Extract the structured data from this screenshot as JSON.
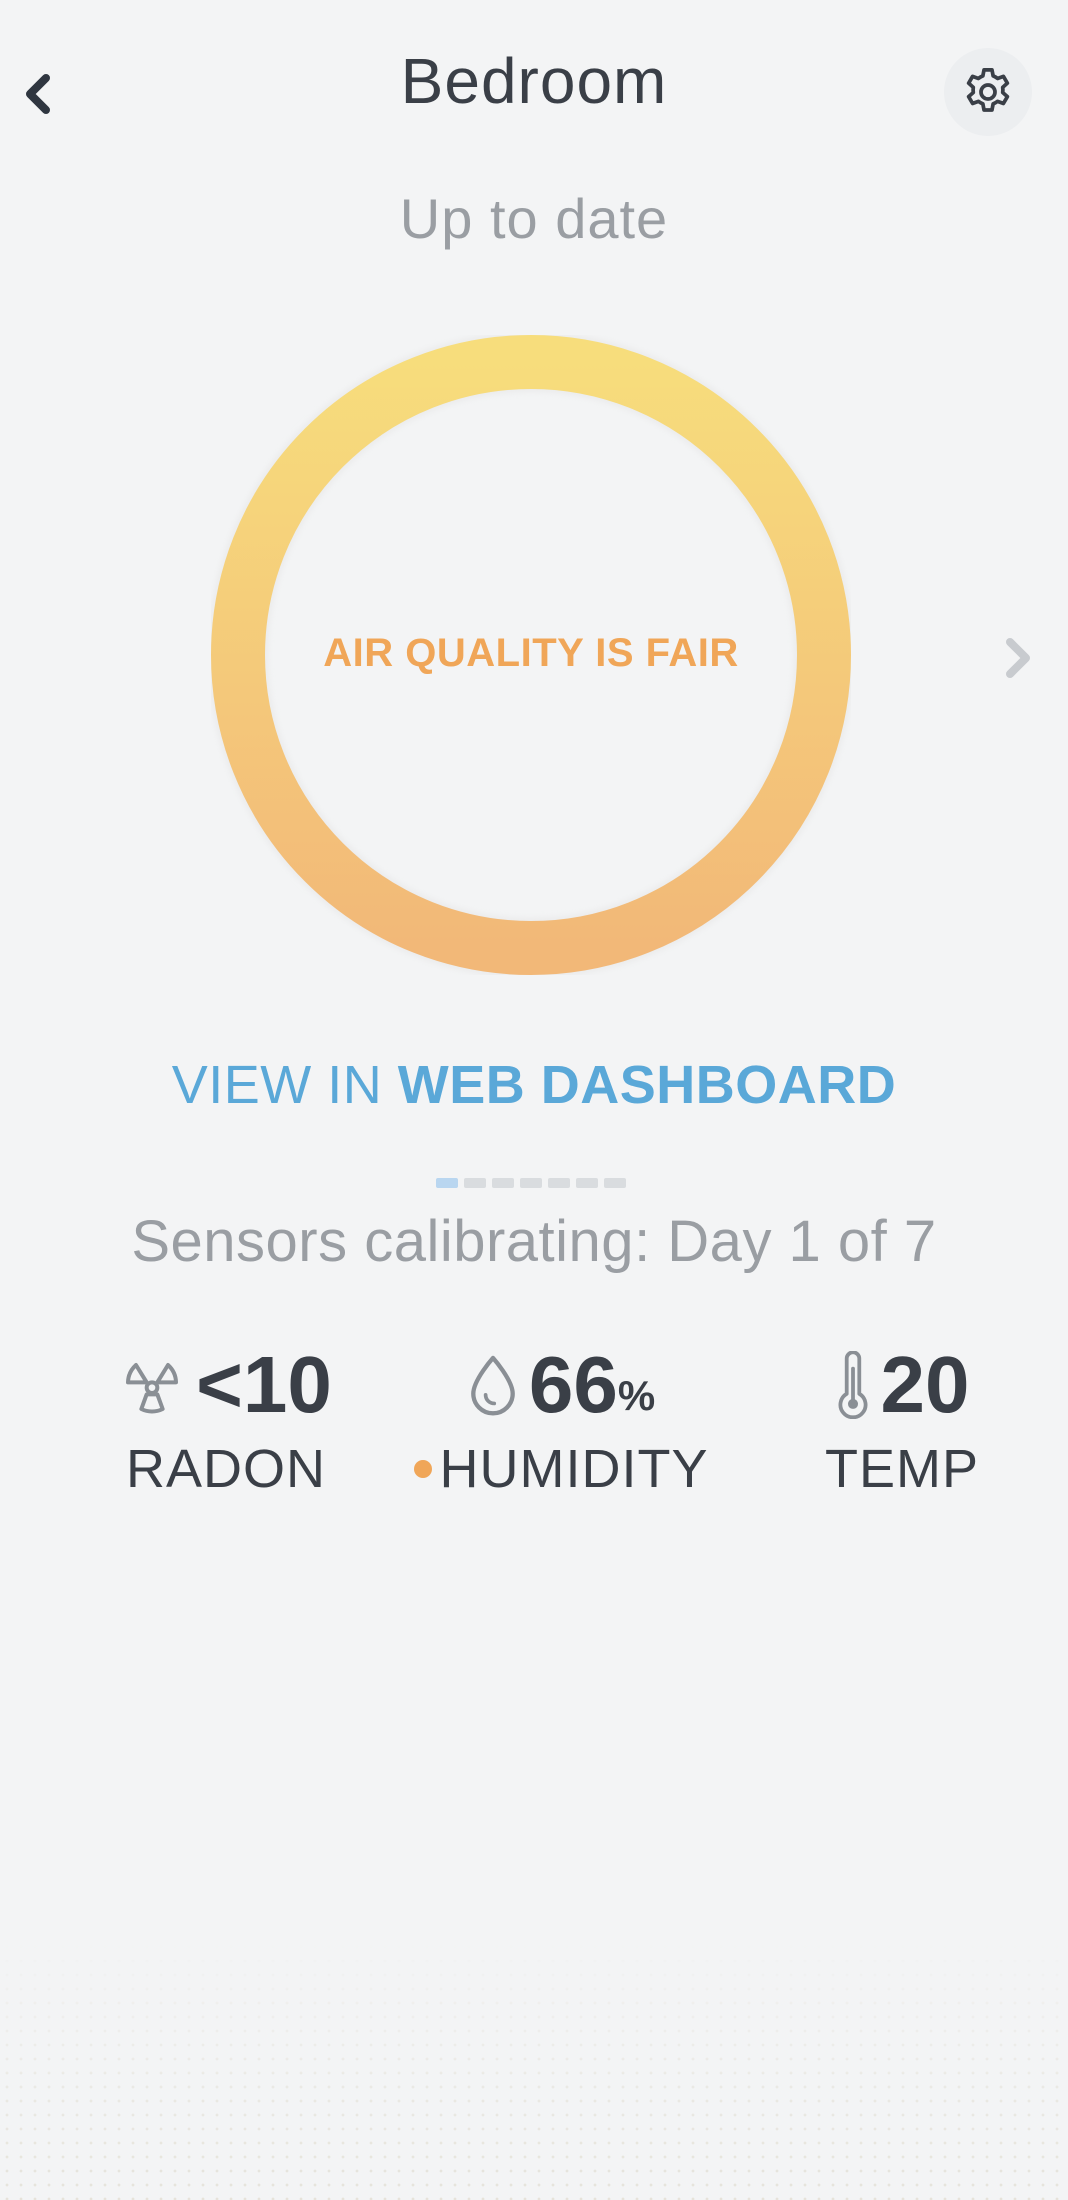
{
  "header": {
    "title": "Bedroom",
    "back_icon": "chevron-left-icon",
    "settings_icon": "gear-icon"
  },
  "status": "Up to date",
  "air_quality": {
    "label": "AIR QUALITY IS FAIR",
    "ring_colors": [
      "#f7dd7c",
      "#f2b878"
    ],
    "label_color": "#f0a658"
  },
  "dashboard_link": {
    "prefix": "VIEW IN ",
    "strong": "WEB DASHBOARD",
    "color": "#5aa8d8"
  },
  "calibration": {
    "text": "Sensors calibrating: Day 1 of 7",
    "current_day": 1,
    "total_days": 7
  },
  "metrics": {
    "radon": {
      "value": "<10",
      "label": "RADON",
      "icon": "radiation-icon"
    },
    "humidity": {
      "value": "66",
      "unit": "%",
      "label": "HUMIDITY",
      "icon": "water-drop-icon",
      "indicator_color": "#f0a658"
    },
    "temp": {
      "value": "20",
      "label": "TEMP",
      "icon": "thermometer-icon"
    }
  }
}
